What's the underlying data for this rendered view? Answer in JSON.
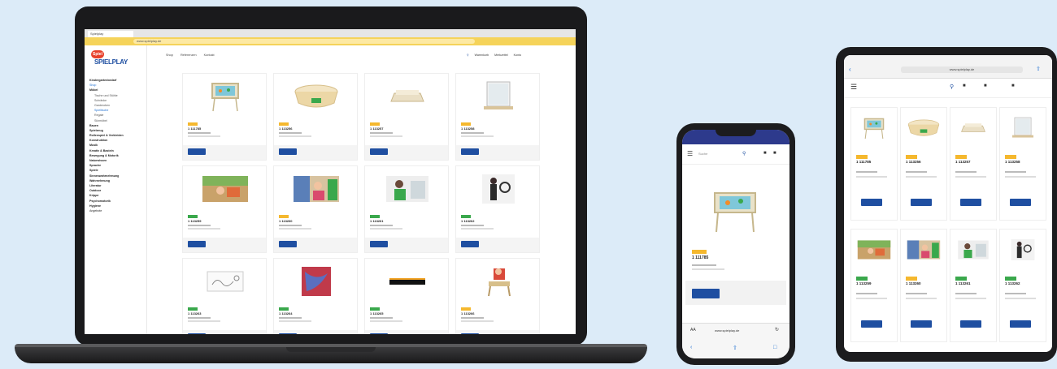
{
  "laptop": {
    "tab_label": "Spielplay",
    "url": "www.spielplay.de",
    "logo_badge": "Spiel",
    "logo_text": "SPIELPLAY",
    "topnav": [
      "Shop",
      "Referenzen",
      "Kontakt"
    ],
    "toolbar": [
      "Warenkorb",
      "Merkzettel",
      "Konto"
    ],
    "sidebar": [
      {
        "label": "Kindergartenbedarf",
        "style": "b"
      },
      {
        "label": "Shop",
        "style": "act"
      },
      {
        "label": "Möbel",
        "style": "b"
      },
      {
        "label": "Tische und Stühle",
        "style": "ind"
      },
      {
        "label": "Schränke",
        "style": "ind"
      },
      {
        "label": "Garderoben",
        "style": "ind"
      },
      {
        "label": "Spieltische",
        "style": "ind act"
      },
      {
        "label": "Regale",
        "style": "ind"
      },
      {
        "label": "Sitzmöbel",
        "style": "ind"
      },
      {
        "label": "Bauen",
        "style": "b"
      },
      {
        "label": "Spielzeug",
        "style": "b"
      },
      {
        "label": "Rollenspiel & Verkleiden",
        "style": "b"
      },
      {
        "label": "Konstruktion",
        "style": "b"
      },
      {
        "label": "Musik",
        "style": "b"
      },
      {
        "label": "Kreativ & Basteln",
        "style": "b"
      },
      {
        "label": "Bewegung & Motorik",
        "style": "b"
      },
      {
        "label": "Naturwissen",
        "style": "b"
      },
      {
        "label": "Sprache",
        "style": "b"
      },
      {
        "label": "Spiele",
        "style": "b"
      },
      {
        "label": "Sinneswahrnehmung",
        "style": "b"
      },
      {
        "label": "Wahrnehmung",
        "style": "b"
      },
      {
        "label": "Literatur",
        "style": "b"
      },
      {
        "label": "Outdoor",
        "style": "b"
      },
      {
        "label": "Krippe",
        "style": "b"
      },
      {
        "label": "Psychomotorik",
        "style": "b"
      },
      {
        "label": "Hygiene",
        "style": "b"
      },
      {
        "label": "Angebote",
        "style": ""
      }
    ],
    "products": [
      {
        "num": "1 111785",
        "badge": "yellow",
        "img": "table"
      },
      {
        "num": "1 113256",
        "badge": "yellow",
        "img": "bowl"
      },
      {
        "num": "1 113257",
        "badge": "yellow",
        "img": "tray"
      },
      {
        "num": "1 113258",
        "badge": "yellow",
        "img": "mirror"
      },
      {
        "num": "1 113259",
        "badge": "green",
        "img": "photo1"
      },
      {
        "num": "1 113260",
        "badge": "yellow",
        "img": "photo2"
      },
      {
        "num": "1 113261",
        "badge": "green",
        "img": "photo3"
      },
      {
        "num": "1 113262",
        "badge": "green",
        "img": "photo4"
      },
      {
        "num": "1 113263",
        "badge": "green",
        "img": "sketch"
      },
      {
        "num": "1 113264",
        "badge": "green",
        "img": "rug"
      },
      {
        "num": "1 113265",
        "badge": "green",
        "img": "mat"
      },
      {
        "num": "1 113266",
        "badge": "yellow",
        "img": "chair"
      }
    ]
  },
  "phone": {
    "search": "Suche",
    "product_num": "1 111785",
    "url": "www.spielplay.de"
  },
  "tablet": {
    "url": "www.spielplay.de",
    "products": [
      {
        "num": "1 111785",
        "badge": "yellow",
        "img": "table"
      },
      {
        "num": "1 113256",
        "badge": "yellow",
        "img": "bowl"
      },
      {
        "num": "1 113257",
        "badge": "yellow",
        "img": "tray"
      },
      {
        "num": "1 113258",
        "badge": "yellow",
        "img": "mirror"
      },
      {
        "num": "1 113259",
        "badge": "green",
        "img": "photo1"
      },
      {
        "num": "1 113260",
        "badge": "yellow",
        "img": "photo2"
      },
      {
        "num": "1 113261",
        "badge": "green",
        "img": "photo3"
      },
      {
        "num": "1 113262",
        "badge": "green",
        "img": "photo4"
      }
    ]
  },
  "colors": {
    "background": "#dcebf8",
    "accent": "#1f4fa1",
    "brand_yellow": "#f5d35a",
    "badge_yellow": "#f5b82e",
    "badge_green": "#3aa84c",
    "phone_header": "#2d3a8c"
  }
}
